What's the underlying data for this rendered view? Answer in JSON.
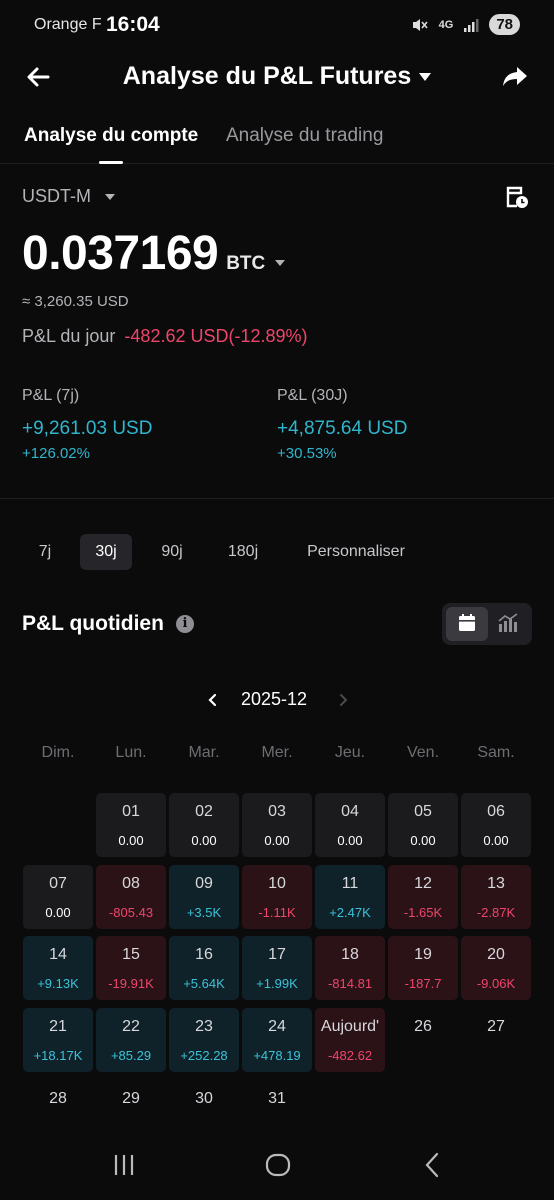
{
  "status_bar": {
    "carrier": "Orange F",
    "time": "16:04",
    "network": "4G",
    "battery": "78",
    "icons": [
      "mute-icon",
      "network-4g-icon",
      "signal-icon"
    ]
  },
  "header": {
    "title": "Analyse du P&L Futures",
    "icons": [
      "back-arrow-icon",
      "chevron-down-icon",
      "share-icon"
    ]
  },
  "tabs": [
    {
      "label": "Analyse du compte",
      "active": true
    },
    {
      "label": "Analyse du trading",
      "active": false
    }
  ],
  "account": {
    "selector": "USDT-M",
    "balance": "0.037169",
    "unit": "BTC",
    "usd_equivalent": "≈ 3,260.35 USD",
    "daily_pnl_label": "P&L du jour",
    "daily_pnl_value": "-482.62 USD(-12.89%)"
  },
  "pnl_summary": [
    {
      "label": "P&L (7j)",
      "amount": "+9,261.03 USD",
      "percent": "+126.02%"
    },
    {
      "label": "P&L (30J)",
      "amount": "+4,875.64 USD",
      "percent": "+30.53%"
    }
  ],
  "periods": [
    {
      "label": "7j",
      "active": false
    },
    {
      "label": "30j",
      "active": true
    },
    {
      "label": "90j",
      "active": false
    },
    {
      "label": "180j",
      "active": false
    },
    {
      "label": "Personnaliser",
      "active": false
    }
  ],
  "daily": {
    "title": "P&L quotidien",
    "info_glyph": "i",
    "month": "2025-12",
    "weekdays": [
      "Dim.",
      "Lun.",
      "Mar.",
      "Mer.",
      "Jeu.",
      "Ven.",
      "Sam."
    ],
    "days": [
      {
        "num": "01",
        "value": "0.00",
        "state": "zero"
      },
      {
        "num": "02",
        "value": "0.00",
        "state": "zero"
      },
      {
        "num": "03",
        "value": "0.00",
        "state": "zero"
      },
      {
        "num": "04",
        "value": "0.00",
        "state": "zero"
      },
      {
        "num": "05",
        "value": "0.00",
        "state": "zero"
      },
      {
        "num": "06",
        "value": "0.00",
        "state": "zero"
      },
      {
        "num": "07",
        "value": "0.00",
        "state": "zero"
      },
      {
        "num": "08",
        "value": "-805.43",
        "state": "neg"
      },
      {
        "num": "09",
        "value": "+3.5K",
        "state": "pos"
      },
      {
        "num": "10",
        "value": "-1.11K",
        "state": "neg"
      },
      {
        "num": "11",
        "value": "+2.47K",
        "state": "pos"
      },
      {
        "num": "12",
        "value": "-1.65K",
        "state": "neg"
      },
      {
        "num": "13",
        "value": "-2.87K",
        "state": "neg"
      },
      {
        "num": "14",
        "value": "+9.13K",
        "state": "pos"
      },
      {
        "num": "15",
        "value": "-19.91K",
        "state": "neg"
      },
      {
        "num": "16",
        "value": "+5.64K",
        "state": "pos"
      },
      {
        "num": "17",
        "value": "+1.99K",
        "state": "pos"
      },
      {
        "num": "18",
        "value": "-814.81",
        "state": "neg"
      },
      {
        "num": "19",
        "value": "-187.7",
        "state": "neg"
      },
      {
        "num": "20",
        "value": "-9.06K",
        "state": "neg"
      },
      {
        "num": "21",
        "value": "+18.17K",
        "state": "pos"
      },
      {
        "num": "22",
        "value": "+85.29",
        "state": "pos"
      },
      {
        "num": "23",
        "value": "+252.28",
        "state": "pos"
      },
      {
        "num": "24",
        "value": "+478.19",
        "state": "pos"
      },
      {
        "num": "Aujourd'",
        "value": "-482.62",
        "state": "neg"
      },
      {
        "num": "26",
        "value": "",
        "state": "empty"
      },
      {
        "num": "27",
        "value": "",
        "state": "empty"
      },
      {
        "num": "28",
        "value": "",
        "state": "empty"
      },
      {
        "num": "29",
        "value": "",
        "state": "empty"
      },
      {
        "num": "30",
        "value": "",
        "state": "empty"
      },
      {
        "num": "31",
        "value": "",
        "state": "empty"
      }
    ]
  },
  "colors": {
    "background": "#0b0b0c",
    "negative": "#f0456b",
    "positive": "#2fb6cc",
    "negative_cell": "#2b1217",
    "positive_cell": "#0f2229",
    "zero_cell": "#1b1b1e"
  },
  "navbar_icons": [
    "recent-apps-icon",
    "home-icon",
    "back-icon"
  ]
}
